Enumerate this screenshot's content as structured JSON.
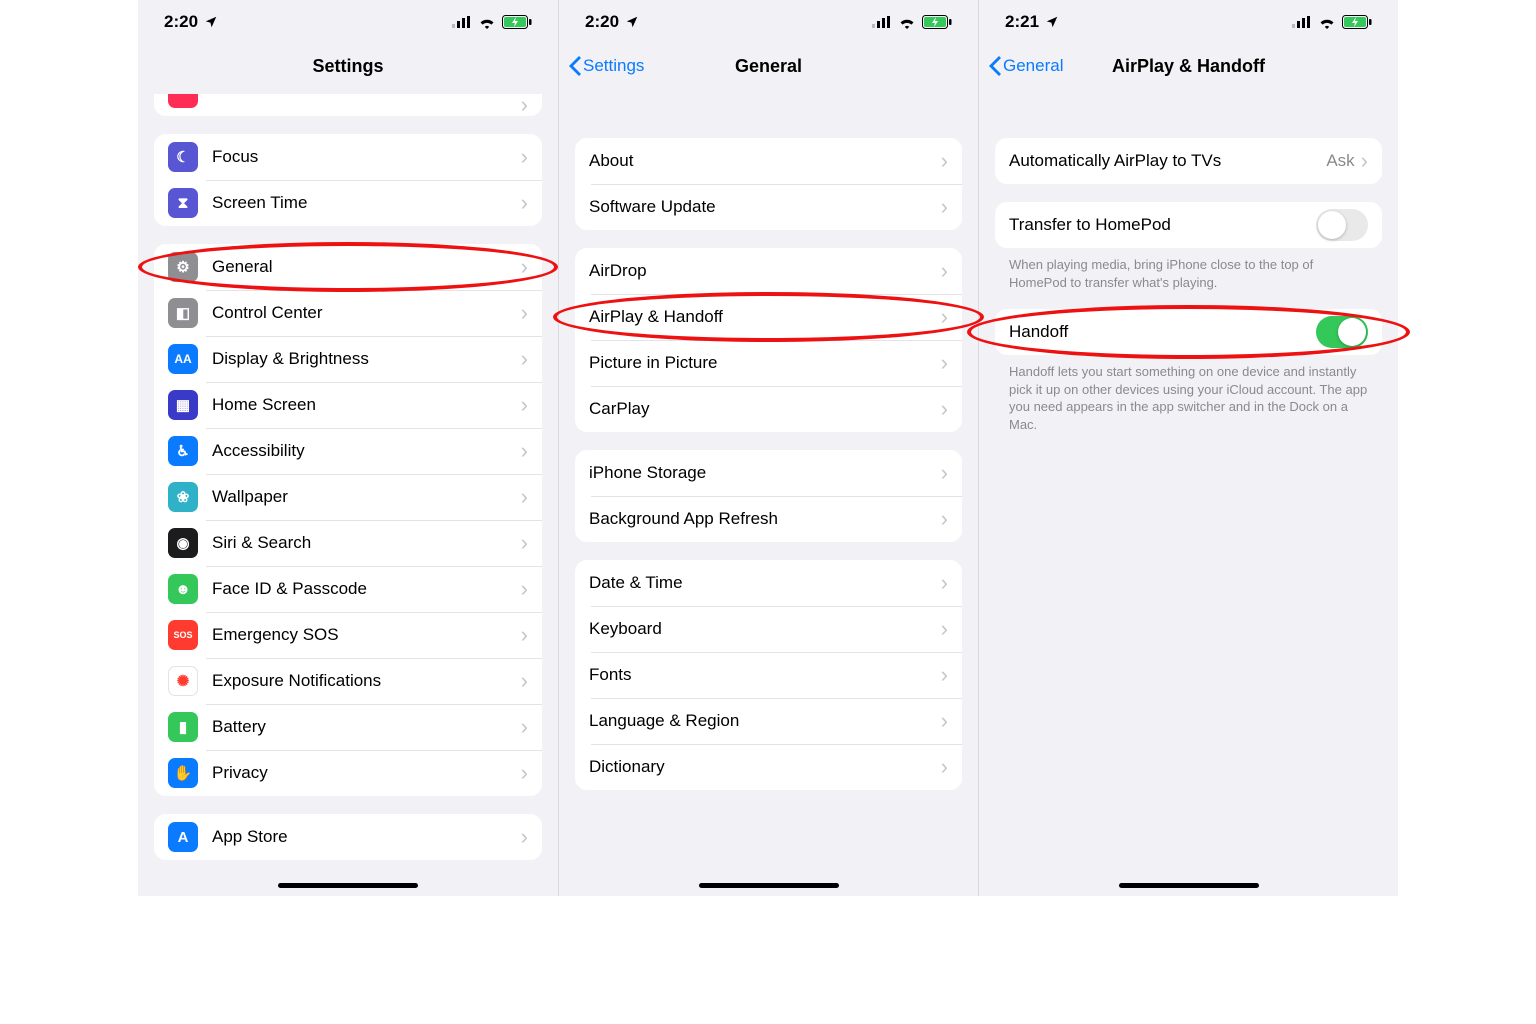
{
  "panels": [
    {
      "status_time": "2:20",
      "nav": {
        "back": "",
        "title": "Settings"
      },
      "groups": [
        {
          "rows": [
            {
              "label": "Focus",
              "icon_bg": "#5856d2",
              "glyph": "☾"
            },
            {
              "label": "Screen Time",
              "icon_bg": "#5856d2",
              "glyph": "⧗"
            }
          ]
        },
        {
          "rows": [
            {
              "label": "General",
              "icon_bg": "#8e8e93",
              "glyph": "⚙"
            },
            {
              "label": "Control Center",
              "icon_bg": "#8e8e93",
              "glyph": "◧"
            },
            {
              "label": "Display & Brightness",
              "icon_bg": "#0a7aff",
              "glyph": "AA"
            },
            {
              "label": "Home Screen",
              "icon_bg": "#3a3ac8",
              "glyph": "▦"
            },
            {
              "label": "Accessibility",
              "icon_bg": "#0a7aff",
              "glyph": "♿︎"
            },
            {
              "label": "Wallpaper",
              "icon_bg": "#2fb1c7",
              "glyph": "❀"
            },
            {
              "label": "Siri & Search",
              "icon_bg": "#1c1c1e",
              "glyph": "◉"
            },
            {
              "label": "Face ID & Passcode",
              "icon_bg": "#34c759",
              "glyph": "☻"
            },
            {
              "label": "Emergency SOS",
              "icon_bg": "#ff3b30",
              "glyph": "SOS"
            },
            {
              "label": "Exposure Notifications",
              "icon_bg": "#ffffff",
              "glyph": "✺",
              "glyph_color": "#ff3b30",
              "icon_border": true
            },
            {
              "label": "Battery",
              "icon_bg": "#34c759",
              "glyph": "▮"
            },
            {
              "label": "Privacy",
              "icon_bg": "#0a7aff",
              "glyph": "✋"
            }
          ]
        },
        {
          "rows": [
            {
              "label": "App Store",
              "icon_bg": "#0a7aff",
              "glyph": "A"
            }
          ]
        }
      ]
    },
    {
      "status_time": "2:20",
      "nav": {
        "back": "Settings",
        "title": "General"
      },
      "groups": [
        {
          "rows": [
            {
              "label": "About"
            },
            {
              "label": "Software Update"
            }
          ]
        },
        {
          "rows": [
            {
              "label": "AirDrop"
            },
            {
              "label": "AirPlay & Handoff"
            },
            {
              "label": "Picture in Picture"
            },
            {
              "label": "CarPlay"
            }
          ]
        },
        {
          "rows": [
            {
              "label": "iPhone Storage"
            },
            {
              "label": "Background App Refresh"
            }
          ]
        },
        {
          "rows": [
            {
              "label": "Date & Time"
            },
            {
              "label": "Keyboard"
            },
            {
              "label": "Fonts"
            },
            {
              "label": "Language & Region"
            },
            {
              "label": "Dictionary"
            }
          ]
        }
      ]
    },
    {
      "status_time": "2:21",
      "nav": {
        "back": "General",
        "title": "AirPlay & Handoff"
      },
      "groups": [
        {
          "rows": [
            {
              "label": "Automatically AirPlay to TVs",
              "value": "Ask",
              "chevron": true
            }
          ]
        },
        {
          "rows": [
            {
              "label": "Transfer to HomePod",
              "toggle": "off"
            }
          ],
          "footer": "When playing media, bring iPhone close to the top of HomePod to transfer what's playing."
        },
        {
          "rows": [
            {
              "label": "Handoff",
              "toggle": "on"
            }
          ],
          "footer": "Handoff lets you start something on one device and instantly pick it up on other devices using your iCloud account. The app you need appears in the app switcher and in the Dock on a Mac."
        }
      ]
    }
  ]
}
